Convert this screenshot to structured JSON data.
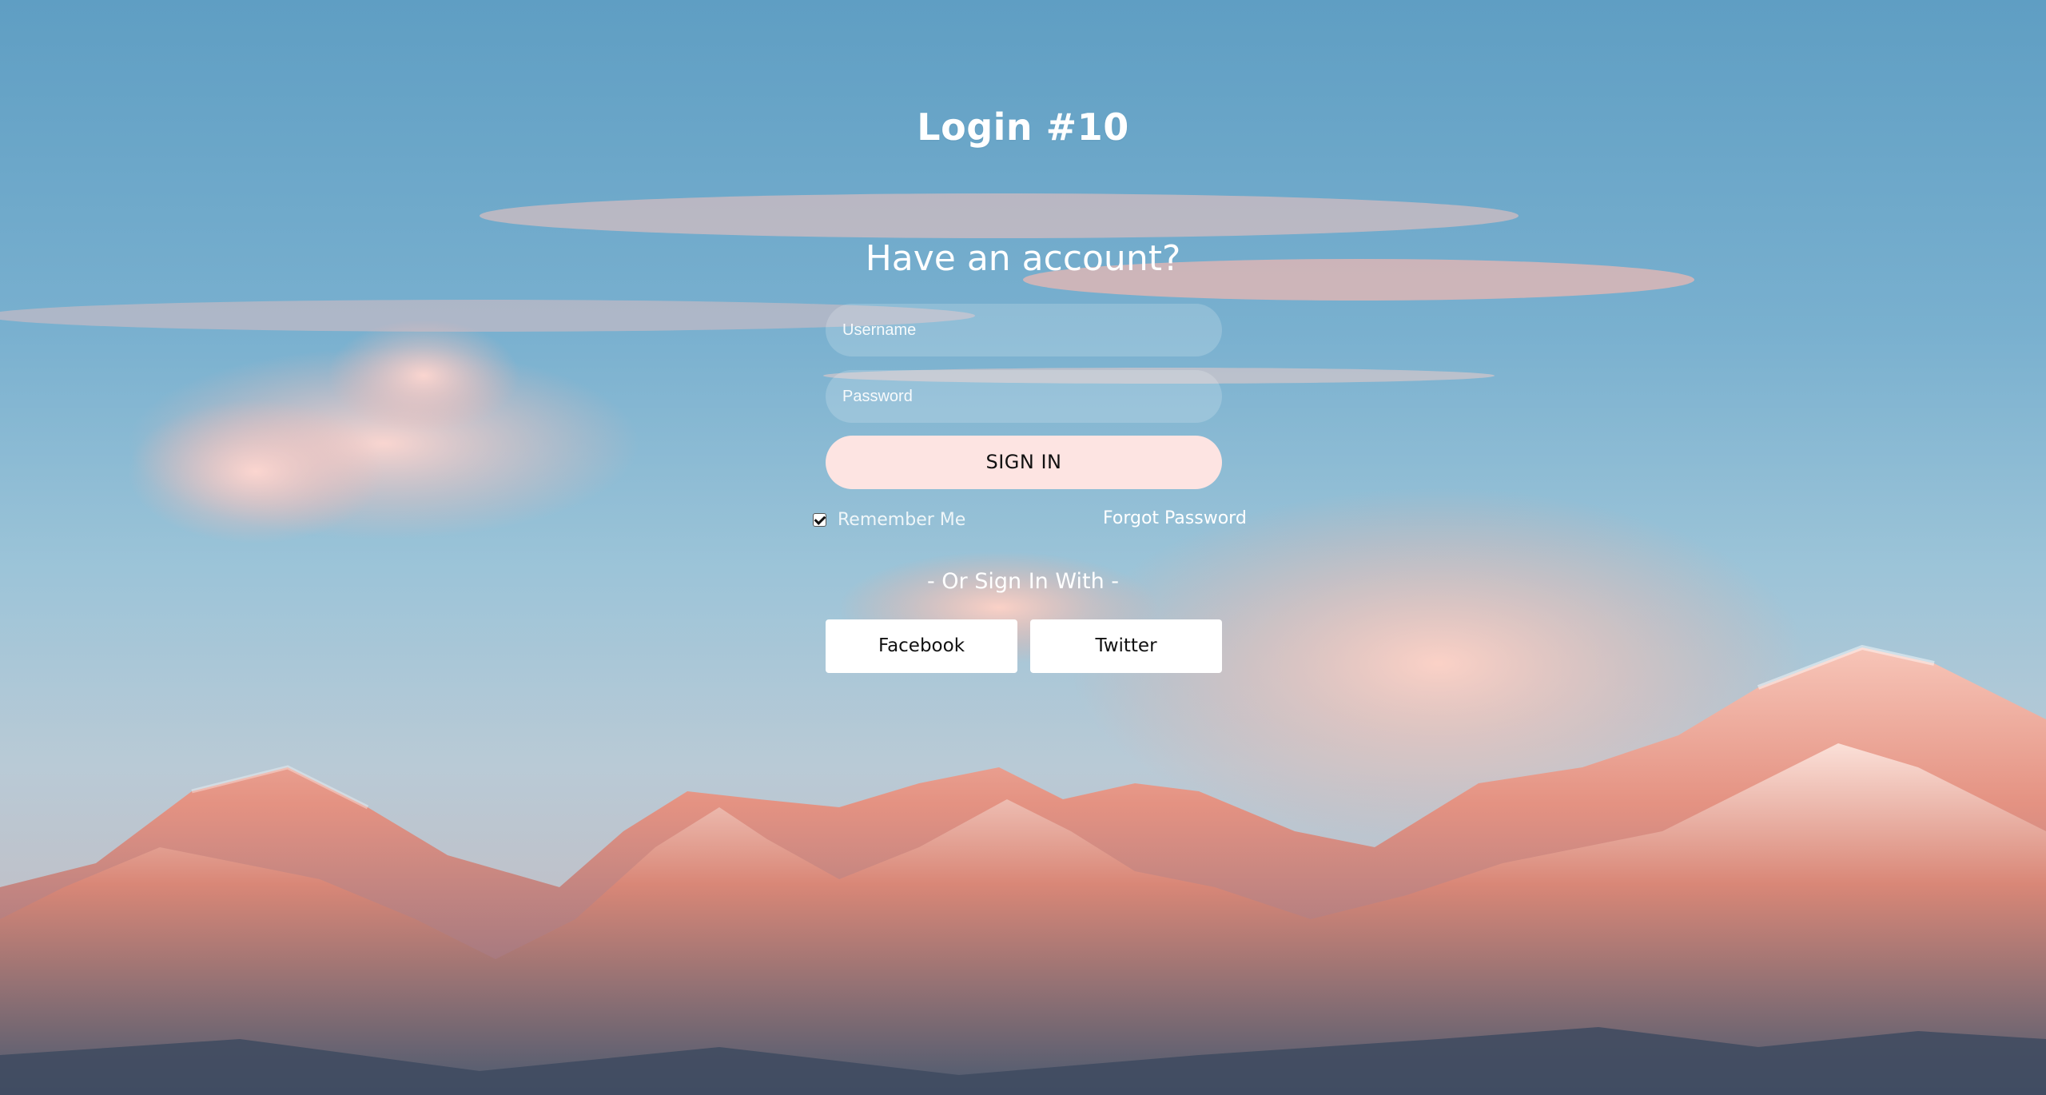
{
  "page": {
    "title": "Login #10",
    "subtitle": "Have an account?"
  },
  "form": {
    "username_placeholder": "Username",
    "username_value": "",
    "password_placeholder": "Password",
    "password_value": "",
    "signin_label": "SIGN IN",
    "remember_label": "Remember Me",
    "remember_checked": true,
    "forgot_label": "Forgot Password"
  },
  "social": {
    "divider": "- Or Sign In With -",
    "facebook_label": "Facebook",
    "twitter_label": "Twitter"
  },
  "colors": {
    "sky": "#6aa5c9",
    "signin_bg": "#fde4e2",
    "text": "#ffffff"
  },
  "icons": {
    "checkbox": "checkbox-checked-icon",
    "background": "mountain-sunset-background"
  }
}
